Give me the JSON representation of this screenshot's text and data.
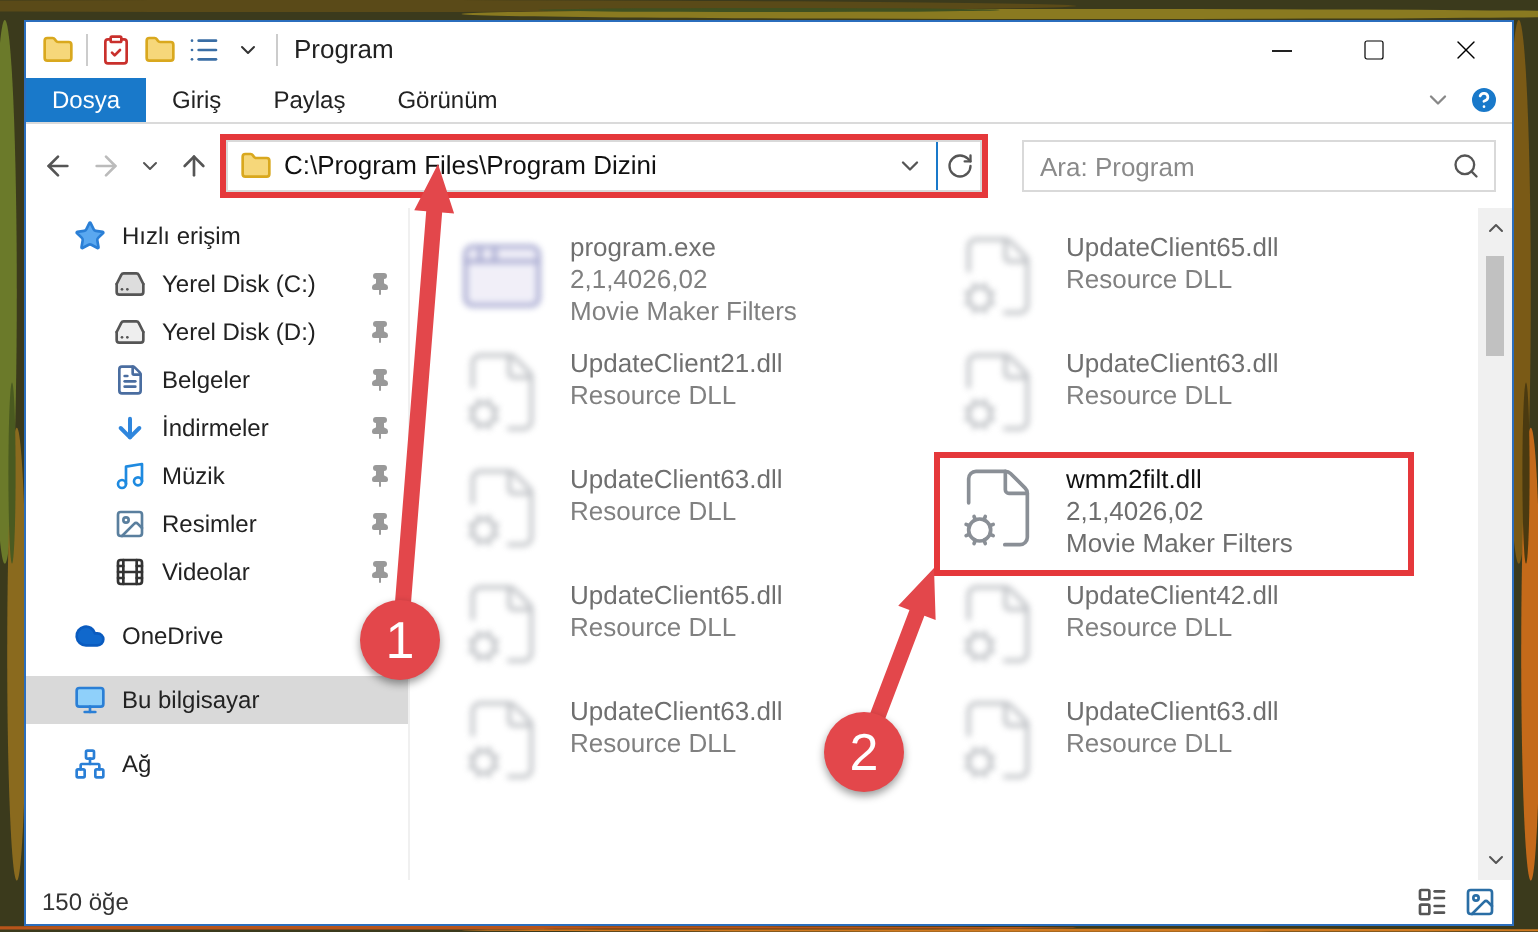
{
  "window": {
    "title": "Program"
  },
  "ribbon_tabs": [
    {
      "label": "Dosya",
      "selected": true
    },
    {
      "label": "Giriş",
      "selected": false
    },
    {
      "label": "Paylaş",
      "selected": false
    },
    {
      "label": "Görünüm",
      "selected": false
    }
  ],
  "address_bar": {
    "path": "C:\\Program Files\\Program Dizini",
    "highlighted": true
  },
  "search": {
    "placeholder": "Ara: Program"
  },
  "sidebar": {
    "items": [
      {
        "label": "Hızlı erişim",
        "kind": "star",
        "selected": false,
        "children": [
          {
            "label": "Yerel Disk (C:)",
            "kind": "drive-windows",
            "pinned": true,
            "selected": false
          },
          {
            "label": "Yerel Disk (D:)",
            "kind": "drive",
            "pinned": true,
            "selected": false
          },
          {
            "label": "Belgeler",
            "kind": "document",
            "pinned": true,
            "selected": false
          },
          {
            "label": "İndirmeler",
            "kind": "download",
            "pinned": true,
            "selected": false
          },
          {
            "label": "Müzik",
            "kind": "music",
            "pinned": true,
            "selected": false
          },
          {
            "label": "Resimler",
            "kind": "pictures",
            "pinned": true,
            "selected": false
          },
          {
            "label": "Videolar",
            "kind": "videos",
            "pinned": true,
            "selected": false
          }
        ]
      },
      {
        "label": "OneDrive",
        "kind": "cloud",
        "selected": false
      },
      {
        "label": "Bu bilgisayar",
        "kind": "computer",
        "selected": true
      },
      {
        "label": "Ağ",
        "kind": "network",
        "selected": false
      }
    ]
  },
  "files": [
    {
      "name": "program.exe",
      "details": [
        "2,1,4026,02",
        "Movie Maker Filters"
      ],
      "kind": "exe",
      "blurred": true,
      "highlighted": false
    },
    {
      "name": "UpdateClient65.dll",
      "details": [
        "Resource DLL"
      ],
      "kind": "dll",
      "blurred": true,
      "highlighted": false
    },
    {
      "name": "UpdateClient21.dll",
      "details": [
        "Resource DLL"
      ],
      "kind": "dll",
      "blurred": true,
      "highlighted": false
    },
    {
      "name": "UpdateClient63.dll",
      "details": [
        "Resource DLL"
      ],
      "kind": "dll",
      "blurred": true,
      "highlighted": false
    },
    {
      "name": "UpdateClient63.dll",
      "details": [
        "Resource DLL"
      ],
      "kind": "dll",
      "blurred": true,
      "highlighted": false
    },
    {
      "name": "wmm2filt.dll",
      "details": [
        "2,1,4026,02",
        "Movie Maker Filters"
      ],
      "kind": "dll",
      "blurred": false,
      "highlighted": true
    },
    {
      "name": "UpdateClient65.dll",
      "details": [
        "Resource DLL"
      ],
      "kind": "dll",
      "blurred": true,
      "highlighted": false
    },
    {
      "name": "UpdateClient42.dll",
      "details": [
        "Resource DLL"
      ],
      "kind": "dll",
      "blurred": true,
      "highlighted": false
    },
    {
      "name": "UpdateClient63.dll",
      "details": [
        "Resource DLL"
      ],
      "kind": "dll",
      "blurred": true,
      "highlighted": false
    },
    {
      "name": "UpdateClient63.dll",
      "details": [
        "Resource DLL"
      ],
      "kind": "dll",
      "blurred": true,
      "highlighted": false
    }
  ],
  "status_bar": {
    "item_count": "150 öğe"
  },
  "annotations": [
    {
      "label": "1"
    },
    {
      "label": "2"
    }
  ]
}
